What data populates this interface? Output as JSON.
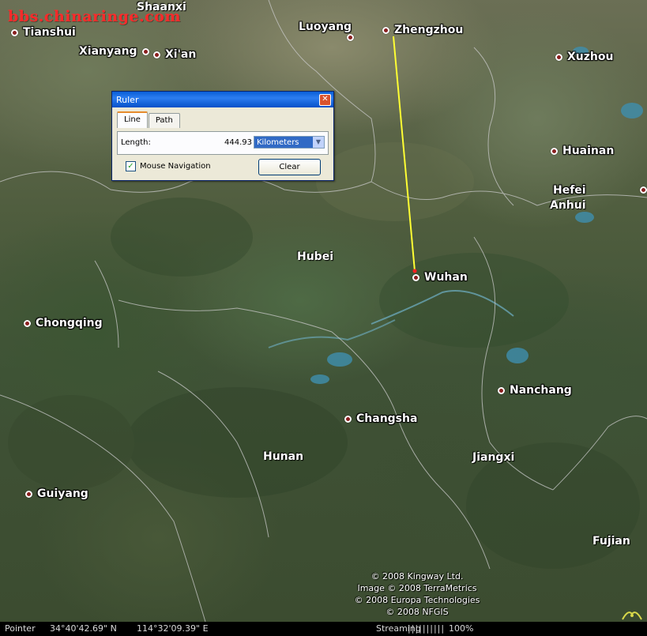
{
  "watermark": "bbs.chinaringe.com",
  "cities": [
    {
      "id": "tianshui",
      "name": "Tianshui"
    },
    {
      "id": "xianyang",
      "name": "Xianyang"
    },
    {
      "id": "xian",
      "name": "Xi'an"
    },
    {
      "id": "luoyang",
      "name": "Luoyang"
    },
    {
      "id": "zhengzhou",
      "name": "Zhengzhou"
    },
    {
      "id": "xuzhou",
      "name": "Xuzhou"
    },
    {
      "id": "huainan",
      "name": "Huainan"
    },
    {
      "id": "hefei",
      "name": "Hefei"
    },
    {
      "id": "wuhan",
      "name": "Wuhan"
    },
    {
      "id": "chongqing",
      "name": "Chongqing"
    },
    {
      "id": "nanchang",
      "name": "Nanchang"
    },
    {
      "id": "changsha",
      "name": "Changsha"
    },
    {
      "id": "guiyang",
      "name": "Guiyang"
    }
  ],
  "provinces": {
    "shaanxi": "Shaanxi",
    "anhui": "Anhui",
    "hubei": "Hubei",
    "hunan": "Hunan",
    "jiangxi": "Jiangxi",
    "fujian": "Fujian"
  },
  "measure_line": {
    "from": "Zhengzhou",
    "to": "Wuhan",
    "color": "#ffff33"
  },
  "ruler": {
    "title": "Ruler",
    "tabs": [
      "Line",
      "Path"
    ],
    "active_tab": "Line",
    "length_label": "Length:",
    "length_value": "444.93",
    "unit": "Kilometers",
    "mouse_nav_label": "Mouse Navigation",
    "mouse_nav_checked": true,
    "clear_label": "Clear"
  },
  "copyright": [
    "© 2008 Kingway Ltd.",
    "Image © 2008 TerraMetrics",
    "© 2008 Europa Technologies",
    "© 2008 NFGIS"
  ],
  "status": {
    "pointer_label": "Pointer",
    "lat": "34°40'42.69\" N",
    "lon": "114°32'09.39\" E",
    "streaming_label": "Streaming",
    "streaming_bar": "||||||||||",
    "streaming_pct": "100%"
  }
}
